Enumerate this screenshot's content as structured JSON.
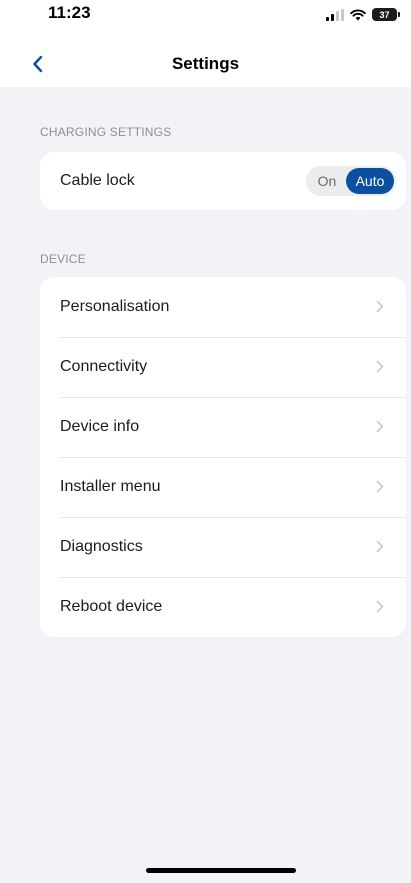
{
  "status_bar": {
    "time": "11:23",
    "battery_level": "37",
    "signal_icon": "signal-bars-icon",
    "wifi_icon": "wifi-icon"
  },
  "nav": {
    "title": "Settings",
    "back_icon": "chevron-left-icon",
    "accent_color": "#0a4fa0"
  },
  "charging_section": {
    "header": "CHARGING SETTINGS",
    "cable_lock": {
      "label": "Cable lock",
      "options": [
        "On",
        "Auto"
      ],
      "selected": "Auto"
    }
  },
  "device_section": {
    "header": "DEVICE",
    "items": [
      {
        "label": "Personalisation"
      },
      {
        "label": "Connectivity"
      },
      {
        "label": "Device info"
      },
      {
        "label": "Installer menu"
      },
      {
        "label": "Diagnostics"
      },
      {
        "label": "Reboot device"
      }
    ],
    "chevron_icon": "chevron-right-icon"
  }
}
